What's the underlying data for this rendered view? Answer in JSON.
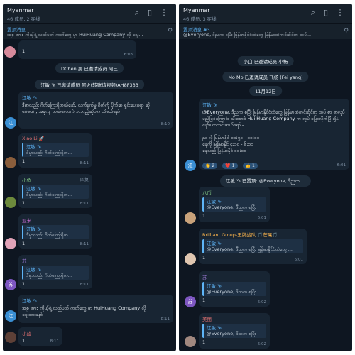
{
  "left": {
    "title": "Myanmar",
    "subtitle": "46 成员, 2 在线",
    "pinned": {
      "label": "置顶消息",
      "text": "အစ္ အား၊ ကိုယ့်ရဲ့ လည်ပတ် ကတ်တွေ မှာ HuiHuang Company လို ရေး..."
    },
    "msg_top": {
      "body": "1",
      "time": "6:03"
    },
    "service1": "DChen 男 已邀请成员 阿三",
    "service2": "江敏 ♑ 已邀请成员 阿火(转账请视频)AH8F333",
    "msg1": {
      "sender": "江敏 ♑",
      "body": "ဒီမှာလည်း ဂိတ်ကြေးရှိတယ်နော်, လက်နက်မှု ဂိတ်ကို ပိုက်ဆံ ရှင်းပေးရော ဆိုပေမယ့် , အခုကျ ဘယ်လောက် ဘဘည့်ဆိုတာ သိမယ်နော်",
      "time": "8:10"
    },
    "msg2": {
      "sender": "Xiao Li 🚀",
      "qname": "江敏 ♑",
      "qtext": "ဒီမှာလည်း ဂိတ်ကြေးရှိတ...",
      "body": "1",
      "time": "8:11"
    },
    "msg3": {
      "sender": "小鱼",
      "reply": "回复",
      "qname": "江敏 ♑",
      "qtext": "ဒီမှာလည်း ဂိတ်ကြေးရှိတ...",
      "body": "1",
      "time": "8:11"
    },
    "msg4": {
      "sender": "亚米",
      "qname": "江敏 ♑",
      "qtext": "ဒီမှာလည်း ဂိတ်ကြေးရှိတ...",
      "body": "1",
      "time": "8:11"
    },
    "msg5": {
      "sender": "苏",
      "qname": "江敏 ♑",
      "qtext": "ဒီမှာလည်း ဂိတ်ကြေးရှိတ...",
      "body": "1",
      "time": "8:11"
    },
    "msg6": {
      "sender": "江敏 ♑",
      "body": "အစ္ အား၊ ကိုယ့်ရဲ့ လည်ပတ် ကတ်တွေ မှာ HuiHuang Company လို ရေးထားနော်",
      "time": "8:11"
    },
    "msg7": {
      "sender": "小蓝",
      "body": "1",
      "time": "8:11"
    },
    "avatars": {
      "jiang": "江",
      "su": "苏"
    }
  },
  "right": {
    "title": "Myanmar",
    "subtitle": "46 成员, 3 在线",
    "pinned": {
      "label": "置顶消息 #3",
      "text": "@Everyone, ဒီညက စပြီး မြန်မာနိုင်ငံထဲတွေ မြန်မာထဲကင်ဆိုင်စာ ထပ်..."
    },
    "service1": "小白 已邀请成员 小杨",
    "service2": "Mo Mo 已邀请成员 飞杨 (Fei yang)",
    "date": "11月12日",
    "msg1": {
      "sender": "江敏 ♑",
      "body": "@Everyone, ဒီညက စပြီး မြန်မာနိုင်ငံထဲတွေ မြန်မာထဲကင်ဆိုင်စာ ထပ် စာ စာလုပ်မည်ဖြစ်ကြောင်း သိအောင် Hui Huang Company က လုပ် ပြောလိုက်ပြီ ချိန်နော်။ ထလင်းဆယ်ရော် -",
      "line2": "ည လို မြန်မာနိုင် ၁၀:၅၀ - ၁၁:၁၀",
      "line3": "နေ့ကို မြန်မာနိုင် ၄:၁၀ - ၆:၁၀",
      "line4": "နေ့လည် မြန်မာနိုင် ၁၁:၁၀",
      "reactions": [
        "👏 2",
        "❤️ 1",
        "👍 1"
      ],
      "time": "6:01"
    },
    "service3": "江敏 ♑ 已置顶: @Everyone, ဒီညက ...",
    "msg2": {
      "sender": "八币",
      "qname": "江敏 ♑",
      "qtext": "@Everyone, ဒီညက စပြီး",
      "body": "1",
      "time": "6:01"
    },
    "msg3": {
      "sender": "Brilliant Group-王牌战队 🎵芒果🎵",
      "qname": "江敏 ♑",
      "qtext": "@Everyone, ဒီညက စပြီး မြန်မာနိုင်ငံထဲတွေ ...",
      "body": "1",
      "time": "6:01"
    },
    "msg4": {
      "sender": "苏",
      "qname": "江敏 ♑",
      "qtext": "@Everyone, ဒီညက စပြီး",
      "body": "1",
      "time": "6:02"
    },
    "msg5": {
      "sender": "美丽",
      "qname": "江敏 ♑",
      "qtext": "@Everyone, ဒီညက စပြီး",
      "body": "1",
      "time": "6:02"
    },
    "avatars": {
      "jiang": "江",
      "su": "苏"
    }
  }
}
